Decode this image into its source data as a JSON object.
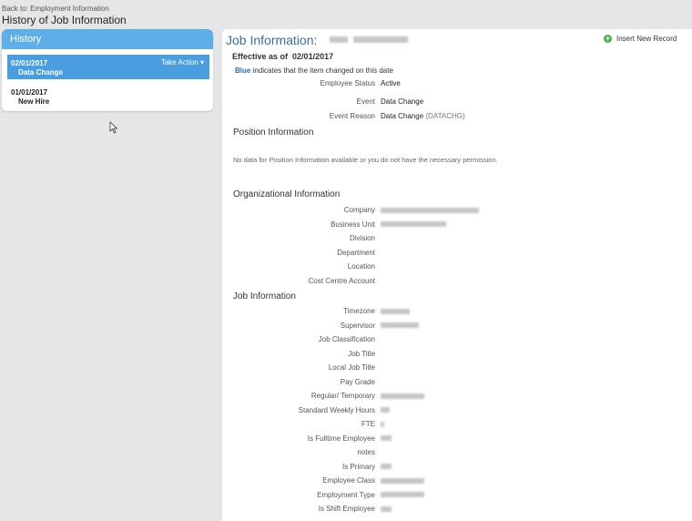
{
  "header": {
    "back_link": "Back to: Employment Information",
    "page_title": "History of Job Information"
  },
  "history": {
    "title": "History",
    "items": [
      {
        "date": "02/01/2017",
        "event": "Data Change",
        "selected": true,
        "action": "Take Action ▾"
      },
      {
        "date": "01/01/2017",
        "event": "New Hire",
        "selected": false
      }
    ]
  },
  "main": {
    "title": "Job Information:",
    "insert_label": "Insert New Record",
    "effective_label": "Effective as of",
    "effective_date": "02/01/2017",
    "legend_blue": "Blue",
    "legend_rest": "indicates that the item changed on this date",
    "top_fields": [
      {
        "label": "Employee Status",
        "value": "Active"
      },
      {
        "label": "Event",
        "value": "Data Change"
      },
      {
        "label": "Event Reason",
        "value": "Data Change",
        "value_suffix": "(DATACHG)"
      }
    ],
    "position_section": {
      "title": "Position Information",
      "no_data": "No data for Position Information available or you do not have the necessary permission."
    },
    "org_section": {
      "title": "Organizational Information",
      "fields": [
        "Company",
        "Business Unit",
        "Division",
        "Department",
        "Location",
        "Cost Centre Account"
      ]
    },
    "job_section": {
      "title": "Job Information",
      "fields": [
        "Timezone",
        "Supervisor",
        "Job Classification",
        "Job Title",
        "Local Job Title",
        "Pay Grade",
        "Regular/ Temporary",
        "Standard Weekly Hours",
        "FTE",
        "Is Fulltime Employee",
        "notes",
        "Is Primary",
        "Employee Class",
        "Employment Type",
        "Is Shift Employee"
      ]
    }
  },
  "colors": {
    "accent": "#5eaee7",
    "selected": "#4a9ee0",
    "title_blue": "#3a6e9e",
    "add_green": "#4caf50"
  }
}
